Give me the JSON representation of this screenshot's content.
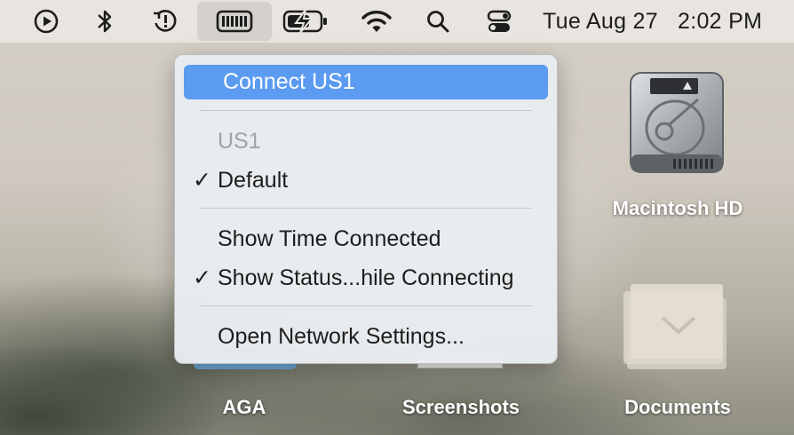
{
  "menubar": {
    "icons": [
      "play-circle-icon",
      "bluetooth-icon",
      "clock-alert-icon",
      "vpn-icon",
      "battery-charging-icon",
      "wifi-icon",
      "search-icon",
      "control-center-icon"
    ],
    "date": "Tue Aug 27",
    "time": "2:02 PM"
  },
  "desktop": {
    "items": [
      {
        "label": "Macintosh HD",
        "icon": "hard-drive-icon"
      },
      {
        "label": "Documents",
        "icon": "folder-icon"
      },
      {
        "label": "AGA",
        "icon": "folder-icon"
      },
      {
        "label": "Screenshots",
        "icon": "folder-icon"
      }
    ]
  },
  "vpn_menu": {
    "connect_label": "Connect US1",
    "section_header": "US1",
    "default_label": "Default",
    "default_checked": true,
    "show_time_label": "Show Time Connected",
    "show_time_checked": false,
    "show_status_label": "Show Status...hile Connecting",
    "show_status_checked": true,
    "open_settings_label": "Open Network Settings..."
  },
  "colors": {
    "highlight": "#5b9bf0",
    "menu_bg": "#e8ecf0",
    "menubar_bg": "#e8e5e0"
  }
}
